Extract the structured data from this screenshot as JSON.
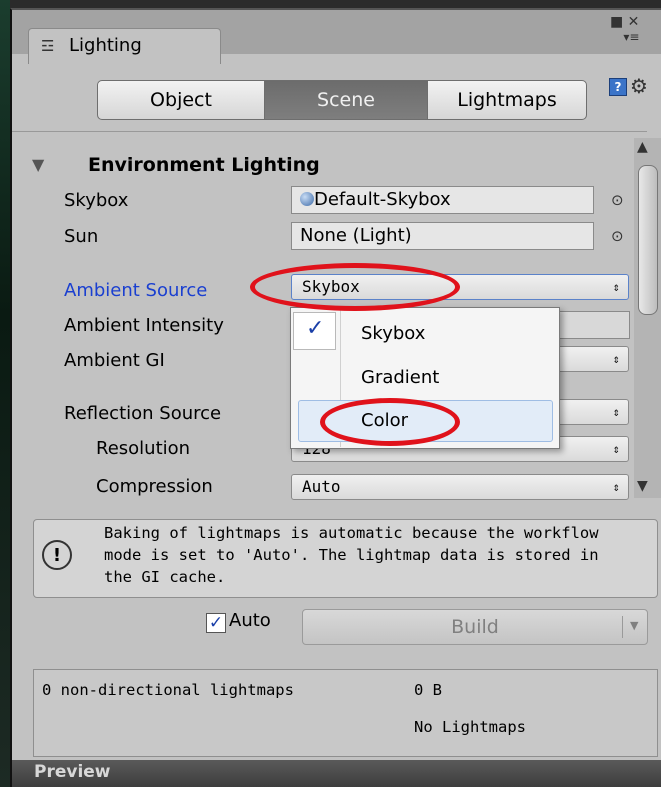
{
  "window": {
    "tab_label": "Lighting",
    "tab_icon": "lighting-tab-icon",
    "controls": "■ ✕",
    "menu_glyph": "▾≡"
  },
  "segments": {
    "object": "Object",
    "scene": "Scene",
    "lightmaps": "Lightmaps",
    "selected": "Scene"
  },
  "section": {
    "title": "Environment Lighting",
    "expanded": true
  },
  "properties": {
    "skybox_label": "Skybox",
    "skybox_value": "Default-Skybox",
    "sun_label": "Sun",
    "sun_value": "None (Light)",
    "ambient_source_label": "Ambient Source",
    "ambient_source_value": "Skybox",
    "ambient_intensity_label": "Ambient Intensity",
    "ambient_gi_label": "Ambient GI",
    "reflection_source_label": "Reflection Source",
    "resolution_label": "Resolution",
    "resolution_value": "128",
    "compression_label": "Compression",
    "compression_value": "Auto"
  },
  "popup": {
    "items": [
      "Skybox",
      "Gradient",
      "Color"
    ],
    "checked": "Skybox",
    "hovered": "Color"
  },
  "info": {
    "text": "Baking of lightmaps is automatic because the workflow\nmode is set to 'Auto'. The lightmap data is stored in\nthe GI cache."
  },
  "build": {
    "auto_label": "Auto",
    "auto_checked": true,
    "build_label": "Build"
  },
  "stats": {
    "count_label": "0 non-directional lightmaps",
    "size": "0 B",
    "status": "No Lightmaps"
  },
  "preview": {
    "label": "Preview"
  },
  "colors": {
    "accent_label": "#1a3fd0",
    "annotation_red": "#e0121b",
    "panel": "#c2c2c2"
  }
}
